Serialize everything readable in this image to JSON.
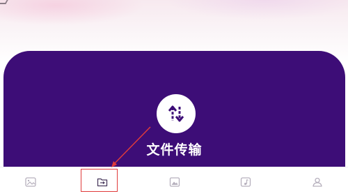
{
  "feature": {
    "label": "文件传输",
    "icon": "transfer-arrows-icon"
  },
  "tabbar": {
    "tabs": [
      {
        "icon": "image-icon",
        "active": false
      },
      {
        "icon": "folder-transfer-icon",
        "active": true
      },
      {
        "icon": "album-icon",
        "active": false
      },
      {
        "icon": "music-icon",
        "active": false
      },
      {
        "icon": "profile-icon",
        "active": false
      }
    ]
  },
  "colors": {
    "card_background": "#3d0d77",
    "annotation": "#e03b3b",
    "tab_icon": "#b6b0bd",
    "tab_icon_active": "#4a3a5e"
  }
}
